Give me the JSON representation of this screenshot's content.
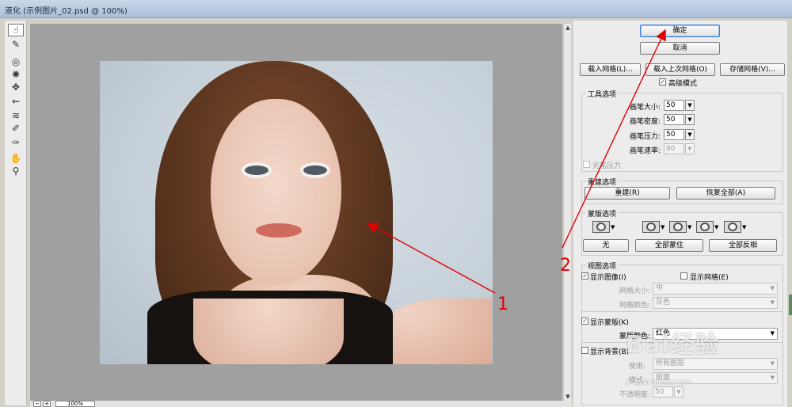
{
  "window": {
    "title": "液化 (示例图片_02.psd @ 100%)"
  },
  "toolbar": {
    "tools": [
      "forward-warp-icon",
      "reconstruct-icon",
      "twirl-icon",
      "pucker-icon",
      "bloat-icon",
      "push-left-icon",
      "mirror-icon",
      "turbulence-icon",
      "freeze-mask-icon",
      "thaw-mask-icon",
      "hand-icon",
      "zoom-icon"
    ]
  },
  "canvas": {
    "zoom": "100%"
  },
  "panel": {
    "ok": "确定",
    "cancel": "取消",
    "load_mesh": "载入网格(L)...",
    "load_last_mesh": "载入上次网格(O)",
    "save_mesh": "存储网格(V)...",
    "advanced_mode": "高级模式",
    "tool_options": {
      "title": "工具选项",
      "brush_size_label": "画笔大小:",
      "brush_size": "50",
      "brush_density_label": "画笔密度:",
      "brush_density": "50",
      "brush_pressure_label": "画笔压力:",
      "brush_pressure": "50",
      "brush_rate_label": "画笔速率:",
      "brush_rate": "80",
      "stylus_pressure": "光笔压力"
    },
    "reconstruct_options": {
      "title": "重建选项",
      "reconstruct": "重建(R)",
      "restore_all": "恢复全部(A)"
    },
    "mask_options": {
      "title": "蒙版选项",
      "none": "无",
      "mask_all": "全部蒙住",
      "invert_all": "全部反相"
    },
    "view_options": {
      "title": "视图选项",
      "show_image": "显示图像(I)",
      "show_mesh": "显示网格(E)",
      "mesh_size_label": "网格大小:",
      "mesh_size": "中",
      "mesh_color_label": "网格颜色:",
      "mesh_color": "灰色",
      "show_mask": "显示蒙版(K)",
      "mask_color_label": "蒙版颜色:",
      "mask_color": "红色",
      "show_backdrop": "显示背景(B)",
      "use_label": "使用:",
      "use_value": "所有图层",
      "mode_label": "模式:",
      "mode_value": "前面",
      "opacity_label": "不透明度:",
      "opacity_value": "50"
    }
  },
  "annotations": {
    "label_1": "1",
    "label_2": "2",
    "color": "#e20000"
  },
  "watermark": {
    "text": "Bai经验",
    "sub": "jingyan.baidu.com"
  }
}
